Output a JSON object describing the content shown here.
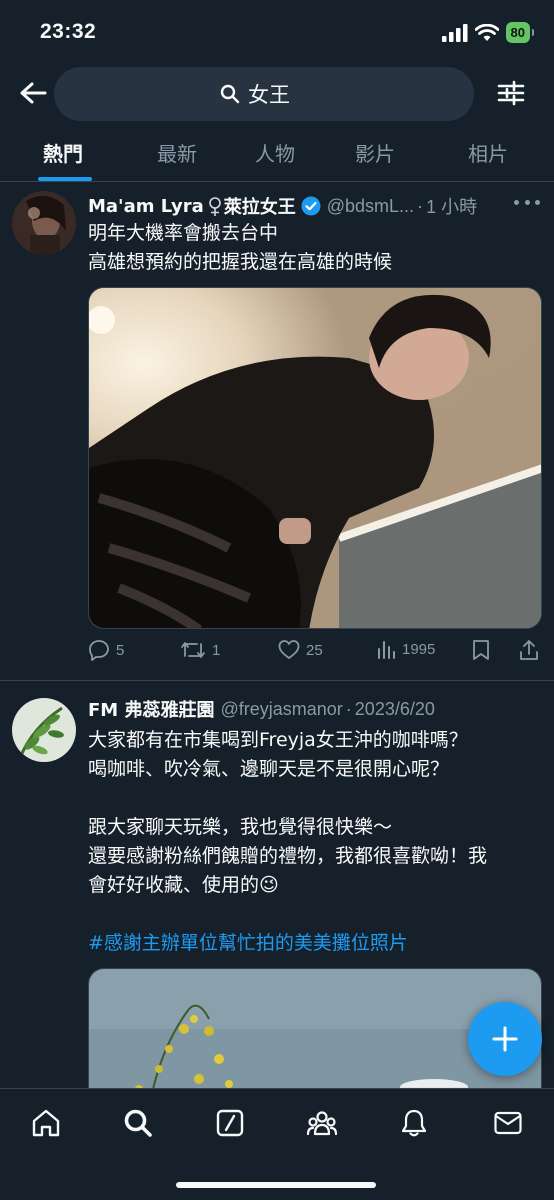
{
  "status": {
    "time": "23:32",
    "battery": "80"
  },
  "search": {
    "query": "女王"
  },
  "tabs": [
    {
      "label": "熱門",
      "active": true
    },
    {
      "label": "最新"
    },
    {
      "label": "人物"
    },
    {
      "label": "影片"
    },
    {
      "label": "相片"
    }
  ],
  "tweets": [
    {
      "name": "Ma'am Lyra",
      "name_suffix": "萊拉女王",
      "verified": true,
      "handle": "@bdsmL...",
      "time": "1 小時",
      "lines": [
        "明年大機率會搬去台中",
        "高雄想預約的把握我還在高雄的時候"
      ],
      "replies": "5",
      "retweets": "1",
      "likes": "25",
      "views": "1995"
    },
    {
      "name": "FM 弗蕊雅莊園",
      "handle": "@freyjasmanor",
      "time": "2023/6/20",
      "line1": "大家都有在市集喝到Freyja女王沖的咖啡嗎？",
      "line2": "喝咖啡、吹冷氣、邊聊天是不是很開心呢？",
      "line3": "跟大家聊天玩樂，我也覺得很快樂～",
      "line4": "還要感謝粉絲們餽贈的禮物，我都很喜歡呦！我",
      "line5": "會好好收藏、使用的",
      "emoji": "😉",
      "hashtag": "#感謝主辦單位幫忙拍的美美攤位照片"
    }
  ]
}
